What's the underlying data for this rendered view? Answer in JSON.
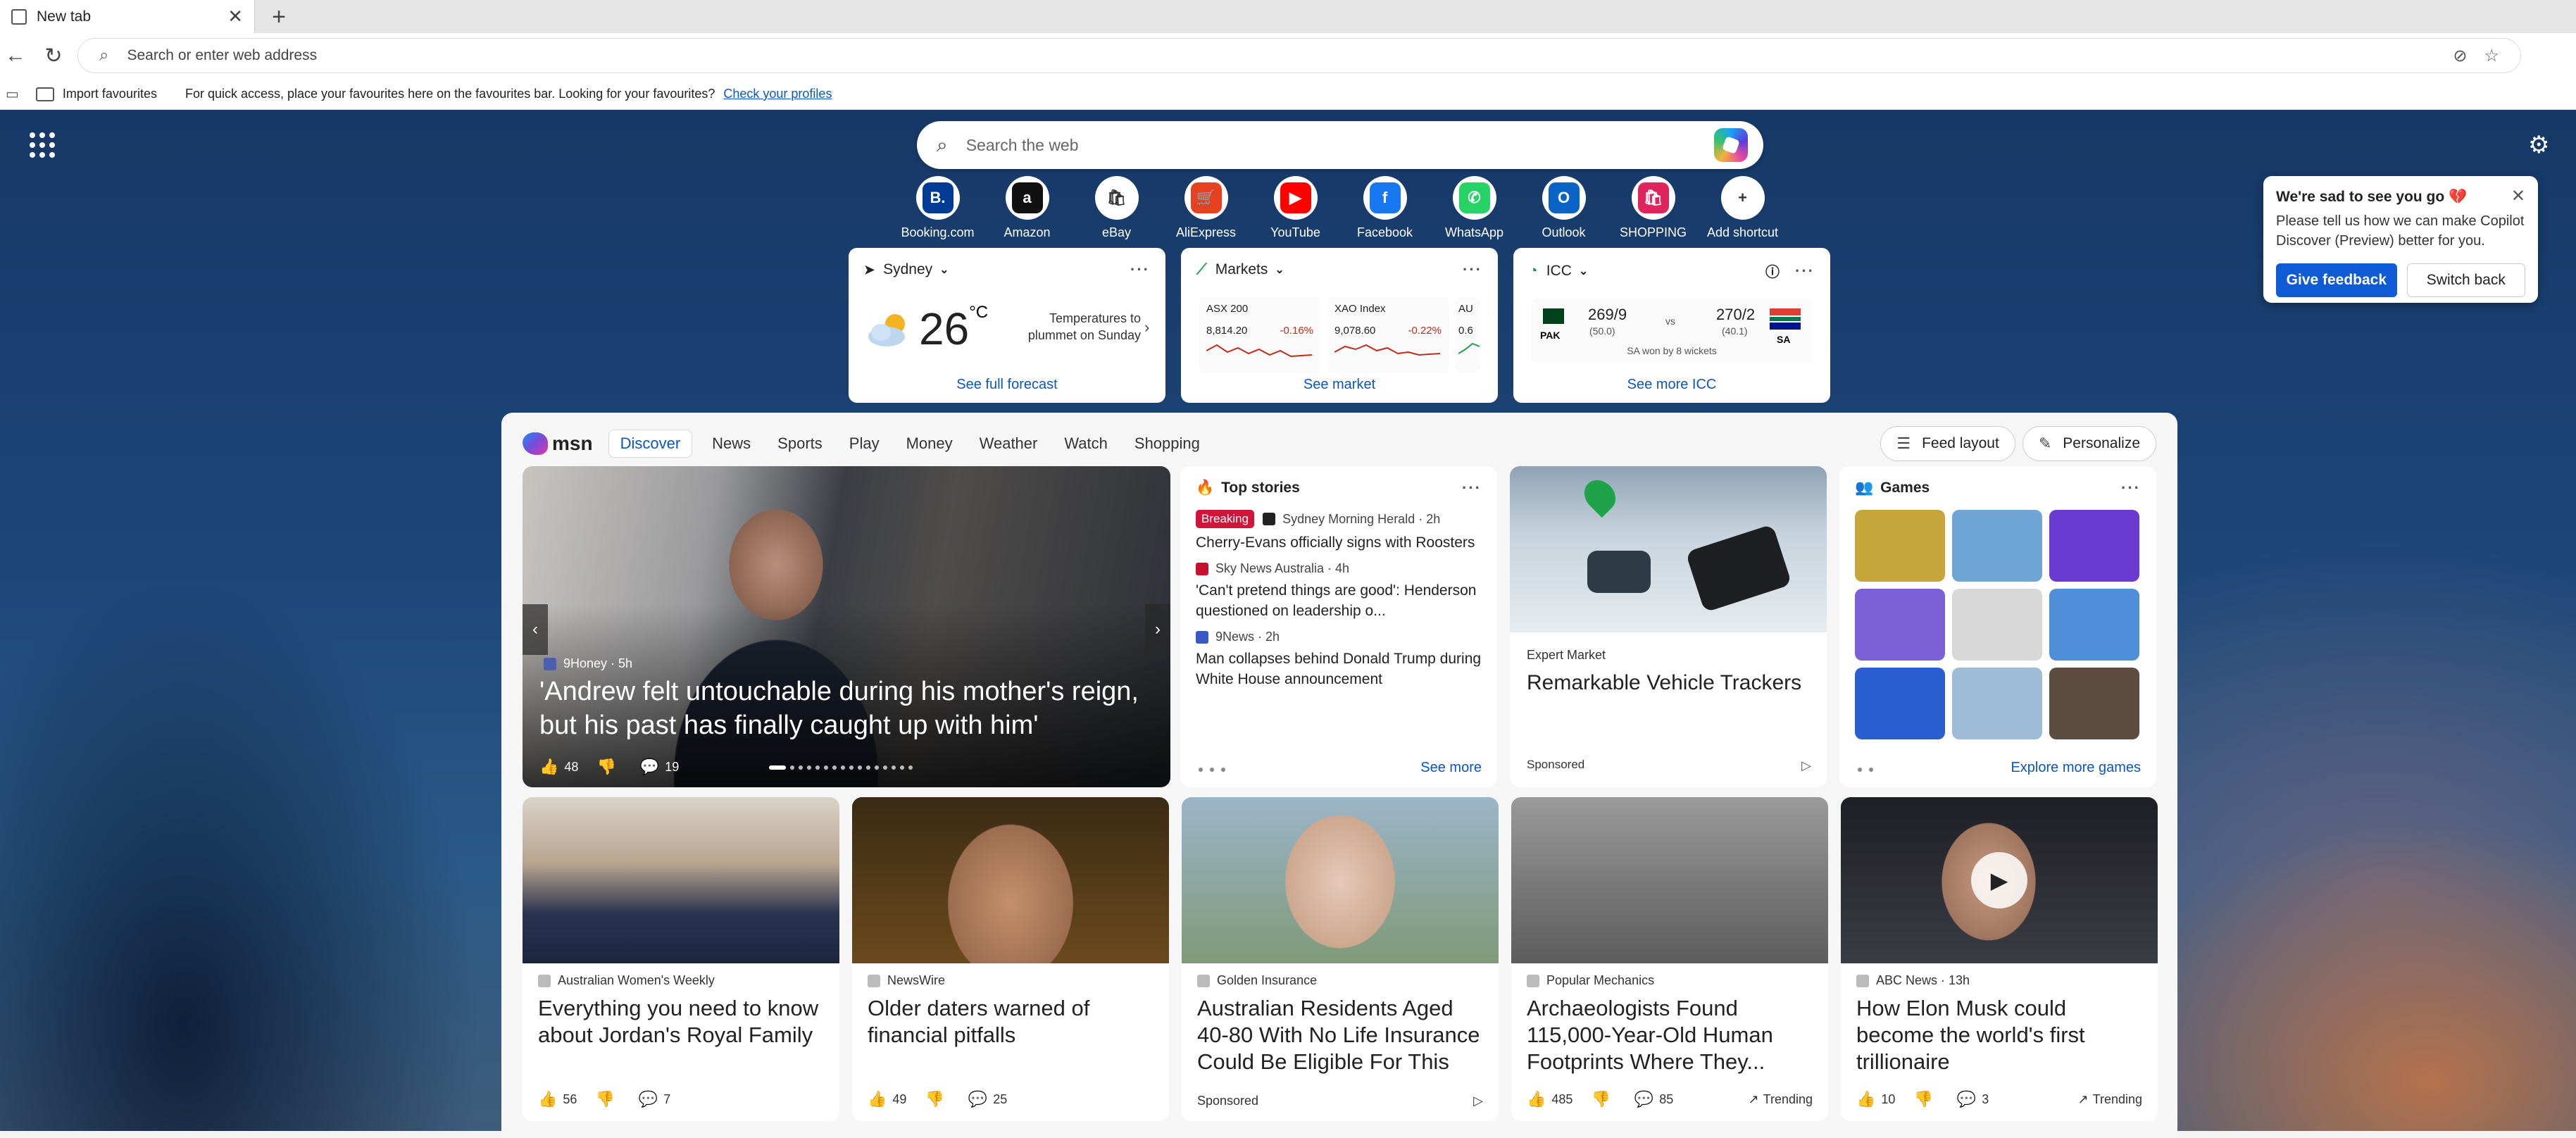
{
  "browser": {
    "tab_title": "New tab",
    "address_placeholder": "Search or enter web address",
    "favbar": {
      "import_label": "Import favourites",
      "message": "For quick access, place your favourites here on the favourites bar. Looking for your favourites?",
      "link": "Check your profiles"
    }
  },
  "search": {
    "placeholder": "Search the web"
  },
  "shortcuts": [
    {
      "label": "Booking.com",
      "glyph": "B.",
      "color": "#003b95"
    },
    {
      "label": "Amazon",
      "glyph": "a",
      "color": "#111111"
    },
    {
      "label": "eBay",
      "glyph": "🛍",
      "color": "#ffffff"
    },
    {
      "label": "AliExpress",
      "glyph": "🛒",
      "color": "#e8411f"
    },
    {
      "label": "YouTube",
      "glyph": "▶",
      "color": "#ff0000"
    },
    {
      "label": "Facebook",
      "glyph": "f",
      "color": "#1877f2"
    },
    {
      "label": "WhatsApp",
      "glyph": "✆",
      "color": "#25d366"
    },
    {
      "label": "Outlook",
      "glyph": "O",
      "color": "#0a64c8"
    },
    {
      "label": "SHOPPING",
      "glyph": "🛍",
      "color": "#e0245e"
    },
    {
      "label": "Add shortcut",
      "glyph": "+",
      "color": "#ffffff"
    }
  ],
  "weather": {
    "location": "Sydney",
    "temp": "26",
    "unit": "°C",
    "note": "Temperatures to plummet on Sunday",
    "link": "See full forecast"
  },
  "markets": {
    "title": "Markets",
    "items": [
      {
        "name": "ASX 200",
        "value": "8,814.20",
        "change": "-0.16%"
      },
      {
        "name": "XAO Index",
        "value": "9,078.60",
        "change": "-0.22%"
      },
      {
        "name": "AU",
        "value": "0.6",
        "change": ""
      }
    ],
    "link": "See market"
  },
  "icc": {
    "title": "ICC",
    "team1": {
      "code": "PAK",
      "score": "269/9",
      "overs": "(50.0)"
    },
    "vs": "vs",
    "team2": {
      "code": "SA",
      "score": "270/2",
      "overs": "(40.1)"
    },
    "result": "SA won by 8 wickets",
    "link": "See more ICC"
  },
  "popup": {
    "title": "We're sad to see you go 💔",
    "body": "Please tell us how we can make Copilot Discover (Preview) better for you.",
    "primary": "Give feedback",
    "secondary": "Switch back"
  },
  "msn": {
    "logo": "msn",
    "tabs": [
      "Discover",
      "News",
      "Sports",
      "Play",
      "Money",
      "Weather",
      "Watch",
      "Shopping"
    ],
    "feed_layout": "Feed layout",
    "personalize": "Personalize"
  },
  "hero": {
    "source": "9Honey · 5h",
    "title": "'Andrew felt untouchable during his mother's reign, but his past has finally caught up with him'",
    "likes": "48",
    "comments": "19"
  },
  "top_stories": {
    "title": "Top stories",
    "badge": "Breaking",
    "items": [
      {
        "source": "Sydney Morning Herald · 2h",
        "headline": "Cherry-Evans officially signs with Roosters"
      },
      {
        "source": "Sky News Australia · 4h",
        "headline": "'Can't pretend things are good': Henderson questioned on leadership o..."
      },
      {
        "source": "9News · 2h",
        "headline": "Man collapses behind Donald Trump during White House announcement"
      }
    ],
    "see_more": "See more"
  },
  "ad": {
    "source": "Expert Market",
    "title": "Remarkable Vehicle Trackers",
    "sponsored": "Sponsored"
  },
  "games": {
    "title": "Games",
    "explore": "Explore more games",
    "tiles": [
      "#c6a63a",
      "#6fa6d6",
      "#6b3bd1",
      "#7a5fd6",
      "#d8d8d8",
      "#4f8fd9",
      "#2b5fd1",
      "#9fbcd6",
      "#5e4b3f"
    ]
  },
  "news": [
    {
      "source": "Australian Women's Weekly",
      "title": "Everything you need to know about Jordan's Royal Family",
      "likes": "56",
      "comments": "7",
      "trend": "",
      "sponsored": ""
    },
    {
      "source": "NewsWire",
      "title": "Older daters warned of financial pitfalls",
      "likes": "49",
      "comments": "25",
      "trend": "",
      "sponsored": ""
    },
    {
      "source": "Golden Insurance",
      "title": "Australian Residents Aged 40-80 With No Life Insurance Could Be Eligible For This",
      "likes": "",
      "comments": "",
      "trend": "",
      "sponsored": "Sponsored"
    },
    {
      "source": "Popular Mechanics",
      "title": "Archaeologists Found 115,000-Year-Old Human Footprints Where They...",
      "likes": "485",
      "comments": "85",
      "trend": "Trending",
      "sponsored": ""
    },
    {
      "source": "ABC News · 13h",
      "title": "How Elon Musk could become the world's first trillionaire",
      "likes": "10",
      "comments": "3",
      "trend": "Trending",
      "sponsored": ""
    }
  ]
}
